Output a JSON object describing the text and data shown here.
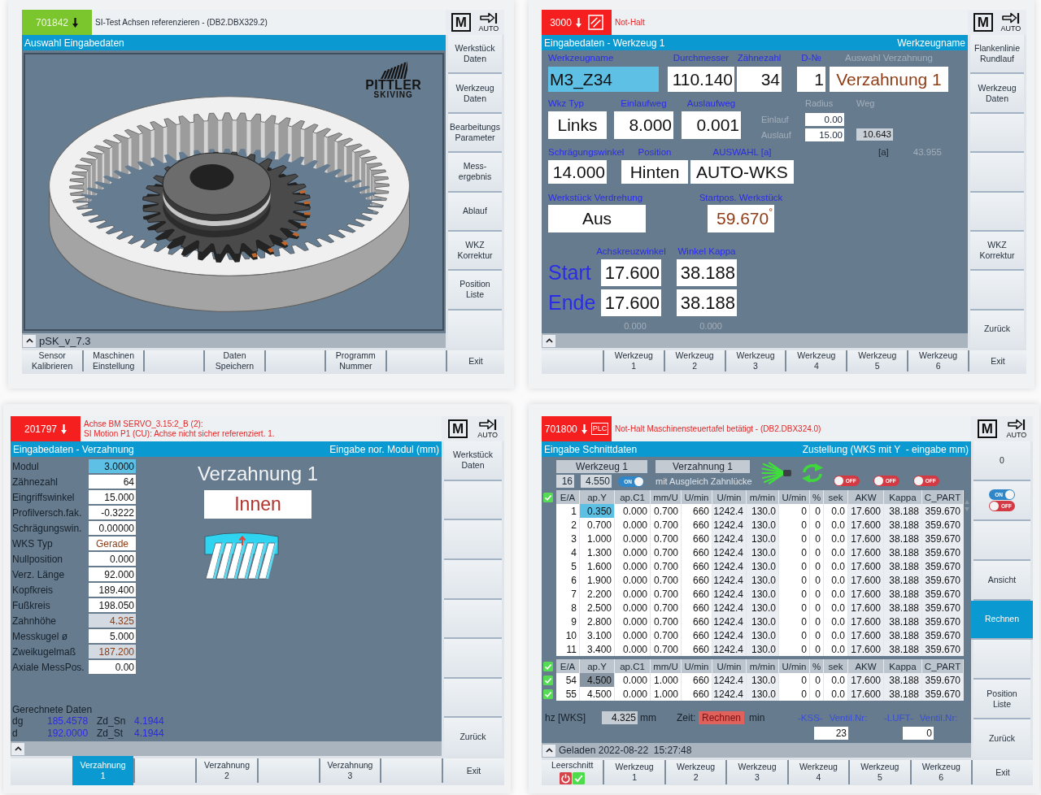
{
  "screens": [
    {
      "alarm": {
        "kind": "message",
        "number": "701842",
        "message": [
          "SI-Test Achsen referenzieren - (DB2.DBX329.2)"
        ]
      },
      "machine_area": "M",
      "mode": "AUTO",
      "title": {
        "left": "Auswahl Eingabedaten"
      },
      "content": {
        "kind": "graphic",
        "logo": [
          "PITTLER",
          "SKIVING"
        ]
      },
      "status_text": "pSK_v_7.3",
      "side_softkeys": [
        {
          "label": "Werkstück\nDaten",
          "selected": false
        },
        {
          "label": "Werkzeug\nDaten",
          "selected": false
        },
        {
          "label": "Bearbeitungs\nParameter",
          "selected": false
        },
        {
          "label": "Mess-\nergebnis",
          "selected": false
        },
        {
          "label": "Ablauf",
          "selected": false
        },
        {
          "label": "WKZ\nKorrektur",
          "selected": false
        },
        {
          "label": "Position\nListe",
          "selected": false
        },
        {
          "selected": false
        }
      ],
      "bottom_softkeys": [
        {
          "label": "Sensor\nKalibrieren",
          "selected": false
        },
        {
          "label": "Maschinen\nEinstellung",
          "selected": false
        },
        {
          "selected": false
        },
        {
          "label": "Daten\nSpeichern",
          "selected": false
        },
        {
          "selected": false
        },
        {
          "label": "Programm\nNummer",
          "selected": false
        },
        {
          "selected": false
        },
        {
          "label": "Exit",
          "selected": false
        }
      ]
    },
    {
      "alarm": {
        "kind": "alarm",
        "number": "3000",
        "source_icon": true,
        "message": [
          "Not-Halt"
        ]
      },
      "machine_area": "M",
      "mode": "AUTO",
      "title": {
        "left": "Eingabedaten - Werkzeug 1",
        "right": "Werkzeugname"
      },
      "content": {
        "kind": "tool_data",
        "fields": [
          {
            "label": "Werkzeugname",
            "value": "M3_Z34",
            "kind": "input",
            "selected": true,
            "disabled": false
          },
          {
            "label": "Durchmesser",
            "value": "110.140",
            "kind": "input",
            "selected": false,
            "disabled": false
          },
          {
            "label": "Zähnezahl",
            "value": "34",
            "kind": "input",
            "selected": false,
            "disabled": false
          },
          {
            "label": "D-№",
            "value": "1",
            "kind": "input",
            "selected": false,
            "disabled": false
          },
          {
            "label": "Auswahl Verzahnung",
            "value": "Verzahnung 1",
            "kind": "toggle",
            "selected": false,
            "disabled": true
          },
          {
            "label": "Wkz Typ",
            "value": "Links",
            "kind": "input",
            "selected": false,
            "disabled": false
          },
          {
            "label": "Einlaufweg",
            "value": "8.000",
            "kind": "input",
            "selected": false,
            "disabled": false
          },
          {
            "label": "Auslaufweg",
            "value": "0.001",
            "kind": "input",
            "selected": false,
            "disabled": false
          },
          {
            "label": "Schrägungswinkel",
            "value": "14.000",
            "kind": "input",
            "selected": false,
            "disabled": false
          },
          {
            "label": "Position",
            "value": "Hinten",
            "kind": "input",
            "selected": false,
            "disabled": false
          },
          {
            "label": "AUSWAHL [a]",
            "value": "AUTO-WKS",
            "kind": "input",
            "selected": false,
            "disabled": false
          },
          {
            "label": "Werkstück Verdrehung",
            "value": "Aus",
            "kind": "input",
            "selected": false,
            "disabled": false
          },
          {
            "label": "Startpos. Werkstück",
            "value": "59.670$^{°}$",
            "kind": "toggle",
            "selected": false,
            "disabled": false
          }
        ],
        "stroke": {
          "headers": [
            "Radius",
            "Weg"
          ],
          "rows": [
            {
              "label": "Einlauf",
              "radius": "0.00"
            },
            {
              "label": "Auslauf",
              "radius": "15.00",
              "path": "10.643"
            }
          ]
        },
        "angle_unit": "[a]",
        "angle_value": "43.955",
        "angles": {
          "columns": [
            "Achskreuzwinkel",
            "Winkel Kappa"
          ],
          "rows": [
            {
              "label": "Start",
              "values": [
                "17.600",
                "38.188"
              ]
            },
            {
              "label": "Ende",
              "values": [
                "17.600",
                "38.188"
              ]
            }
          ],
          "footer": [
            "0.000",
            "0.000"
          ]
        }
      },
      "side_softkeys": [
        {
          "label": "Flankenlinie\nRundlauf",
          "selected": false
        },
        {
          "label": "Werkzeug\nDaten",
          "selected": false
        },
        {
          "selected": false
        },
        {
          "selected": false
        },
        {
          "selected": false
        },
        {
          "label": "WKZ\nKorrektur",
          "selected": false
        },
        {
          "selected": false
        },
        {
          "label": "Zurück",
          "selected": false
        }
      ],
      "bottom_softkeys": [
        {
          "selected": false
        },
        {
          "label": "Werkzeug\n1",
          "selected": false
        },
        {
          "label": "Werkzeug\n2",
          "selected": false
        },
        {
          "label": "Werkzeug\n3",
          "selected": false
        },
        {
          "label": "Werkzeug\n4",
          "selected": false
        },
        {
          "label": "Werkzeug\n5",
          "selected": false
        },
        {
          "label": "Werkzeug\n6",
          "selected": false
        },
        {
          "label": "Exit",
          "selected": false
        }
      ]
    },
    {
      "alarm": {
        "kind": "alarm",
        "number": "201797",
        "message": [
          "Achse BM SERVO_3.15:2_B (2):",
          "SI Motion P1 (CU): Achse nicht sicher referenziert. 1."
        ]
      },
      "machine_area": "M",
      "mode": "AUTO",
      "title": {
        "left": "Eingabedaten - Verzahnung",
        "right": "Eingabe nor. Modul (mm)"
      },
      "content": {
        "kind": "gearing_data",
        "params": [
          {
            "label": "Modul",
            "value": "3.0000",
            "kind": "input",
            "selected": true
          },
          {
            "label": "Zähnezahl",
            "value": "64",
            "kind": "input",
            "selected": false
          },
          {
            "label": "Eingriffswinkel",
            "value": "15.000",
            "kind": "input",
            "selected": false
          },
          {
            "label": "Profilversch.fak.",
            "value": "-0.3222",
            "kind": "input",
            "selected": false
          },
          {
            "label": "Schrägungswin.",
            "value": "0.00000",
            "kind": "input",
            "selected": false
          },
          {
            "label": "WKS Typ",
            "value": "Gerade",
            "kind": "toggle",
            "selected": false
          },
          {
            "label": "Nullposition",
            "value": "0.000",
            "kind": "input",
            "selected": false
          },
          {
            "label": "Verz. Länge",
            "value": "92.000",
            "kind": "input",
            "selected": false
          },
          {
            "label": "Kopfkreis",
            "value": "189.400",
            "kind": "input",
            "selected": false
          },
          {
            "label": "Fußkreis",
            "value": "198.050",
            "kind": "input",
            "selected": false
          },
          {
            "label": "Zahnhöhe",
            "value": "4.325",
            "kind": "output",
            "selected": false
          },
          {
            "label": "Messkugel ø",
            "value": "5.000",
            "kind": "input",
            "selected": false
          },
          {
            "label": "Zweikugelmaß",
            "value": "187.200",
            "kind": "output",
            "selected": false
          },
          {
            "label": "Axiale MessPos.",
            "value": "0.00",
            "kind": "input",
            "selected": false
          }
        ],
        "heading": "Verzahnung 1",
        "gearing_type": "Innen",
        "computed": {
          "title": "Gerechnete Daten",
          "rows": [
            [
              {
                "name": "dg",
                "value": "185.4578"
              },
              {
                "name": "Zd_Sn",
                "value": "4.1944"
              }
            ],
            [
              {
                "name": "d",
                "value": "192.0000"
              },
              {
                "name": "Zd_St",
                "value": "4.1944"
              }
            ]
          ]
        }
      },
      "side_softkeys": [
        {
          "label": "Werkstück\nDaten",
          "selected": false
        },
        {
          "selected": false
        },
        {
          "selected": false
        },
        {
          "selected": false
        },
        {
          "selected": false
        },
        {
          "selected": false
        },
        {
          "selected": false
        },
        {
          "label": "Zurück",
          "selected": false
        }
      ],
      "bottom_softkeys": [
        {
          "selected": false
        },
        {
          "label": "Verzahnung\n1",
          "selected": true
        },
        {
          "selected": false
        },
        {
          "label": "Verzahnung\n2",
          "selected": false
        },
        {
          "selected": false
        },
        {
          "label": "Verzahnung\n3",
          "selected": false
        },
        {
          "selected": false
        },
        {
          "label": "Exit",
          "selected": false
        }
      ]
    },
    {
      "alarm": {
        "kind": "alarm",
        "number": "701800",
        "source_label": "PLC",
        "message": [
          "Not-Halt Maschinensteuertafel betätigt - (DB2.DBX324.0)"
        ]
      },
      "machine_area": "M",
      "mode": "AUTO",
      "title": {
        "left": "Eingabe Schnittdaten",
        "right": "Zustellung (WKS mit Y  - eingabe mm)"
      },
      "content": {
        "kind": "cutting_data",
        "tool": "Werkzeug 1",
        "gearing": "Verzahnung 1",
        "cut_count": "16",
        "cut_value": "4.550",
        "gap_switch": {
          "on": true,
          "text": "ON"
        },
        "gap_label": "mit Ausgleich Zahnlücke",
        "switches": [
          {
            "on": false,
            "text": "OFF"
          },
          {
            "on": false,
            "text": "OFF"
          },
          {
            "on": false,
            "text": "OFF"
          }
        ],
        "tables": [
          {
            "checked": true,
            "focused": true,
            "columns": [
              {
                "label": "E/A",
                "computed": false
              },
              {
                "label": "ap.Y",
                "computed": false
              },
              {
                "label": "ap.C1",
                "computed": false
              },
              {
                "label": "mm/U",
                "computed": false
              },
              {
                "label": "U/min",
                "computed": false
              },
              {
                "label": "U/min",
                "computed": true
              },
              {
                "label": "m/min",
                "computed": true
              },
              {
                "label": "U/min",
                "computed": false
              },
              {
                "label": "%",
                "computed": false
              },
              {
                "label": "sek",
                "computed": false
              },
              {
                "label": "AKW",
                "computed": true
              },
              {
                "label": "Kappa",
                "computed": true
              },
              {
                "label": "C_PART",
                "computed": true
              }
            ],
            "rows": [
              {
                "cells": [
                  "1",
                  "0.350",
                  "0.000",
                  "0.700",
                  "660",
                  "1242.4",
                  "130.0",
                  "0",
                  "0",
                  "0.0",
                  "17.600",
                  "38.188",
                  "359.670"
                ],
                "selected": true
              },
              {
                "cells": [
                  "2",
                  "0.700",
                  "0.000",
                  "0.700",
                  "660",
                  "1242.4",
                  "130.0",
                  "0",
                  "0",
                  "0.0",
                  "17.600",
                  "38.188",
                  "359.670"
                ],
                "selected": false
              },
              {
                "cells": [
                  "3",
                  "1.000",
                  "0.000",
                  "0.700",
                  "660",
                  "1242.4",
                  "130.0",
                  "0",
                  "0",
                  "0.0",
                  "17.600",
                  "38.188",
                  "359.670"
                ],
                "selected": false
              },
              {
                "cells": [
                  "4",
                  "1.300",
                  "0.000",
                  "0.700",
                  "660",
                  "1242.4",
                  "130.0",
                  "0",
                  "0",
                  "0.0",
                  "17.600",
                  "38.188",
                  "359.670"
                ],
                "selected": false
              },
              {
                "cells": [
                  "5",
                  "1.600",
                  "0.000",
                  "0.700",
                  "660",
                  "1242.4",
                  "130.0",
                  "0",
                  "0",
                  "0.0",
                  "17.600",
                  "38.188",
                  "359.670"
                ],
                "selected": false
              },
              {
                "cells": [
                  "6",
                  "1.900",
                  "0.000",
                  "0.700",
                  "660",
                  "1242.4",
                  "130.0",
                  "0",
                  "0",
                  "0.0",
                  "17.600",
                  "38.188",
                  "359.670"
                ],
                "selected": false
              },
              {
                "cells": [
                  "7",
                  "2.200",
                  "0.000",
                  "0.700",
                  "660",
                  "1242.4",
                  "130.0",
                  "0",
                  "0",
                  "0.0",
                  "17.600",
                  "38.188",
                  "359.670"
                ],
                "selected": false
              },
              {
                "cells": [
                  "8",
                  "2.500",
                  "0.000",
                  "0.700",
                  "660",
                  "1242.4",
                  "130.0",
                  "0",
                  "0",
                  "0.0",
                  "17.600",
                  "38.188",
                  "359.670"
                ],
                "selected": false
              },
              {
                "cells": [
                  "9",
                  "2.800",
                  "0.000",
                  "0.700",
                  "660",
                  "1242.4",
                  "130.0",
                  "0",
                  "0",
                  "0.0",
                  "17.600",
                  "38.188",
                  "359.670"
                ],
                "selected": false
              },
              {
                "cells": [
                  "10",
                  "3.100",
                  "0.000",
                  "0.700",
                  "660",
                  "1242.4",
                  "130.0",
                  "0",
                  "0",
                  "0.0",
                  "17.600",
                  "38.188",
                  "359.670"
                ],
                "selected": false
              },
              {
                "cells": [
                  "11",
                  "3.400",
                  "0.000",
                  "0.700",
                  "660",
                  "1242.4",
                  "130.0",
                  "0",
                  "0",
                  "0.0",
                  "17.600",
                  "38.188",
                  "359.670"
                ],
                "selected": false
              }
            ]
          },
          {
            "checked": true,
            "focused": false,
            "columns": [
              {
                "label": "E/A",
                "computed": false
              },
              {
                "label": "ap.Y",
                "computed": false
              },
              {
                "label": "ap.C1",
                "computed": false
              },
              {
                "label": "mm/U",
                "computed": false
              },
              {
                "label": "U/min",
                "computed": false
              },
              {
                "label": "U/min",
                "computed": true
              },
              {
                "label": "m/min",
                "computed": true
              },
              {
                "label": "U/min",
                "computed": false
              },
              {
                "label": "%",
                "computed": false
              },
              {
                "label": "sek",
                "computed": false
              },
              {
                "label": "AKW",
                "computed": true
              },
              {
                "label": "Kappa",
                "computed": true
              },
              {
                "label": "C_PART",
                "computed": true
              }
            ],
            "rows": [
              {
                "cells": [
                  "54",
                  "4.500",
                  "0.000",
                  "1.000",
                  "660",
                  "1242.4",
                  "130.0",
                  "0",
                  "0",
                  "0.0",
                  "17.600",
                  "38.188",
                  "359.670"
                ],
                "selected": true,
                "checked": true
              },
              {
                "cells": [
                  "55",
                  "4.500",
                  "0.000",
                  "1.000",
                  "660",
                  "1242.4",
                  "130.0",
                  "0",
                  "0",
                  "0.0",
                  "17.600",
                  "38.188",
                  "359.670"
                ],
                "selected": false,
                "checked": true
              }
            ]
          }
        ],
        "depth": {
          "label": "hz [WKS]",
          "value": "4.325",
          "unit": "mm"
        },
        "time": {
          "label": "Zeit:",
          "value": "Rechnen",
          "unit": "min"
        },
        "valves": [
          {
            "label": "-KSS-",
            "caption": "Ventil.Nr:",
            "value": "23"
          },
          {
            "label": "-LUFT-",
            "caption": "Ventil.Nr:",
            "value": "0"
          }
        ]
      },
      "status_text": "Geladen 2022-08-22  15:27:48",
      "side_softkeys": [
        {
          "kind": "text",
          "label": "0",
          "selected": false
        },
        {
          "kind": "switches",
          "switches": [
            {
              "on": true,
              "text": "ON"
            },
            {
              "on": false,
              "text": "OFF"
            }
          ],
          "selected": false
        },
        {
          "kind": "text",
          "selected": false
        },
        {
          "kind": "text",
          "label": "Ansicht",
          "selected": false
        },
        {
          "kind": "text",
          "label": "Rechnen",
          "selected": true
        },
        {
          "kind": "text",
          "selected": false
        },
        {
          "kind": "text",
          "label": "Position\nListe",
          "selected": false
        },
        {
          "kind": "text",
          "label": "Zurück",
          "selected": false
        }
      ],
      "bottom_softkeys": [
        {
          "kind": "icons",
          "label": "Leerschnitt",
          "selected": false
        },
        {
          "kind": "text",
          "label": "Werkzeug\n1",
          "selected": false
        },
        {
          "kind": "text",
          "label": "Werkzeug\n2",
          "selected": false
        },
        {
          "kind": "text",
          "label": "Werkzeug\n3",
          "selected": false
        },
        {
          "kind": "text",
          "label": "Werkzeug\n4",
          "selected": false
        },
        {
          "kind": "text",
          "label": "Werkzeug\n5",
          "selected": false
        },
        {
          "kind": "text",
          "label": "Werkzeug\n6",
          "selected": false
        },
        {
          "kind": "text",
          "label": "Exit",
          "selected": false
        }
      ]
    }
  ]
}
